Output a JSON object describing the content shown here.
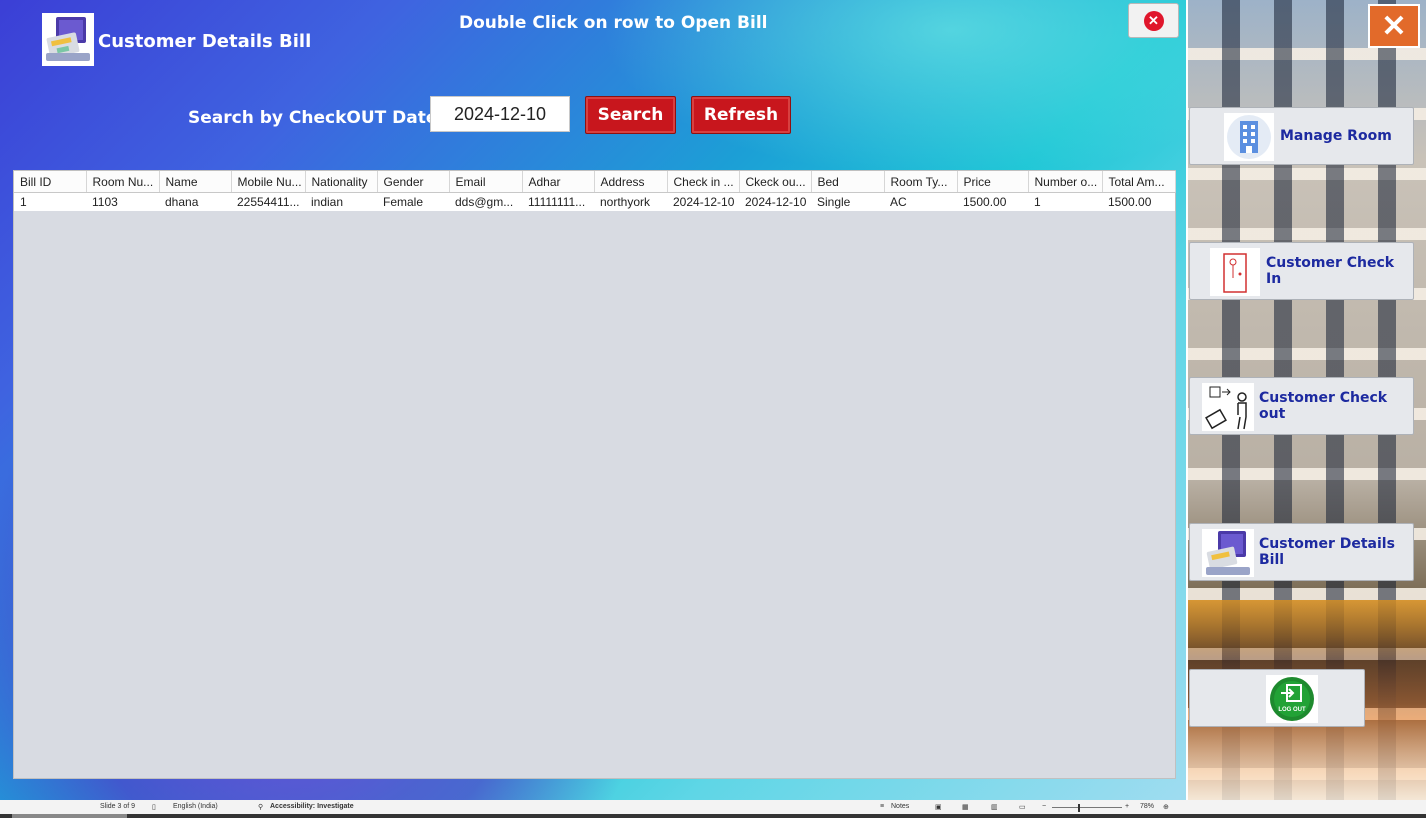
{
  "header": {
    "title": "Customer Details Bill",
    "hint": "Double Click on row to Open Bill"
  },
  "search": {
    "label": "Search by CheckOUT Date",
    "date_value": "2024-12-10",
    "search_label": "Search",
    "refresh_label": "Refresh"
  },
  "table": {
    "columns": [
      "Bill ID",
      "Room Nu...",
      "Name",
      "Mobile Nu...",
      "Nationality",
      "Gender",
      "Email",
      "Adhar",
      "Address",
      "Check in ...",
      "Ckeck ou...",
      "Bed",
      "Room Ty...",
      "Price",
      "Number o...",
      "Total Am..."
    ],
    "rows": [
      [
        "1",
        "1103",
        "dhana",
        "22554411...",
        "indian",
        "Female",
        "dds@gm...",
        "11111111...",
        "northyork",
        "2024-12-10",
        "2024-12-10",
        "Single",
        "AC",
        "1500.00",
        "1",
        "1500.00"
      ]
    ]
  },
  "sidebar": {
    "items": [
      {
        "label": "Manage Room",
        "icon": "building-icon"
      },
      {
        "label": "Customer Check In",
        "icon": "door-icon"
      },
      {
        "label": "Customer Check out",
        "icon": "person-luggage-icon"
      },
      {
        "label": "Customer Details Bill",
        "icon": "bill-laptop-icon"
      },
      {
        "label": "LOG OUT",
        "icon": "logout-icon"
      }
    ]
  },
  "statusbar": {
    "slide": "Slide 3 of 9",
    "language": "English (India)",
    "accessibility": "Accessibility: Investigate",
    "notes": "Notes",
    "zoom": "78%"
  },
  "colors": {
    "accent_red": "#c8161d",
    "nav_text": "#1d2aa0",
    "close_orange": "#e26a2a"
  }
}
